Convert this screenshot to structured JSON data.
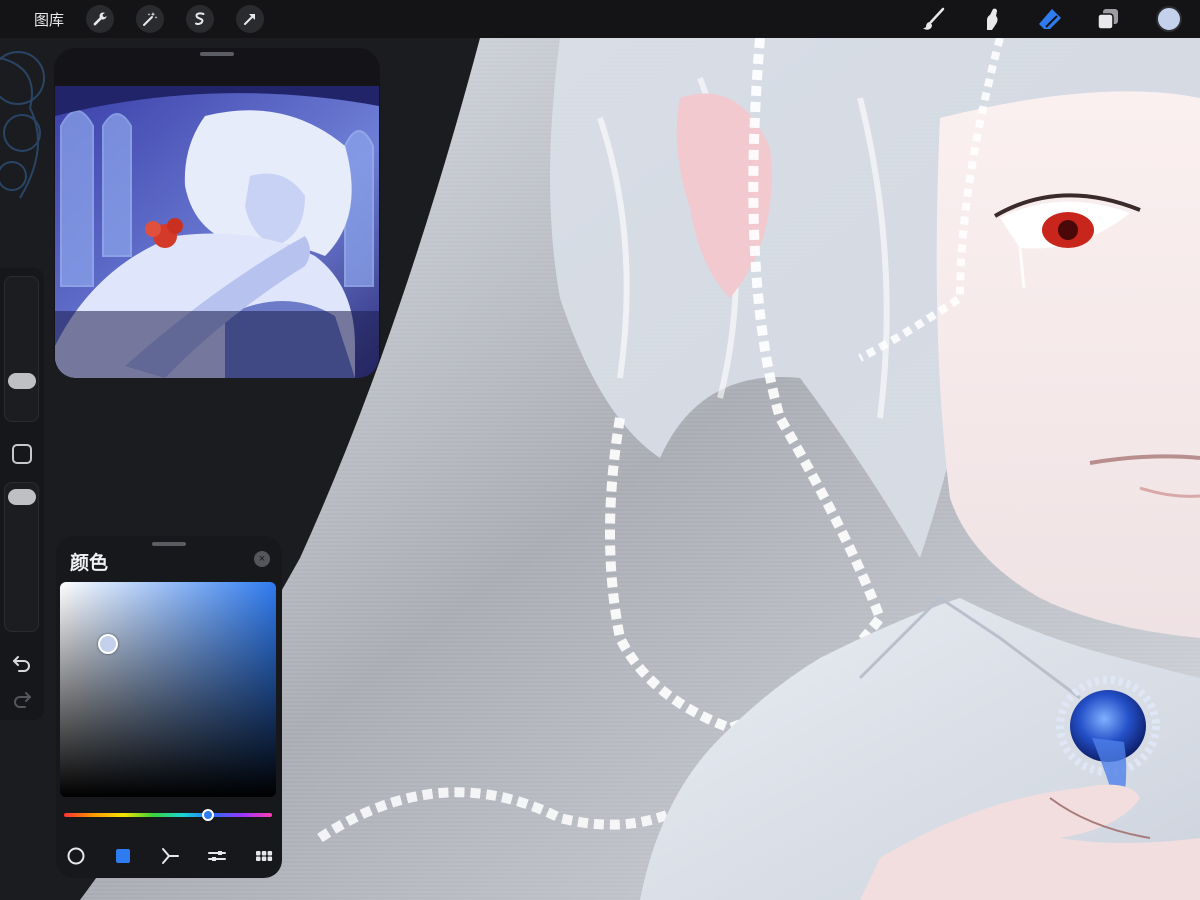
{
  "app": "Procreate",
  "topbar": {
    "gallery_label": "图库",
    "left_tools": [
      "wrench-icon",
      "magic-wand-icon",
      "selection-icon",
      "transform-arrow-icon"
    ],
    "right_tools": [
      "brush-icon",
      "smudge-icon",
      "eraser-icon",
      "layers-icon"
    ],
    "active_tool": "eraser-icon",
    "current_color": "#c3d1ec",
    "accent": "#2f7bf0"
  },
  "sidebar": {
    "controls": [
      "brush-size-slider",
      "modify-button",
      "opacity-slider",
      "undo-icon",
      "redo-icon"
    ]
  },
  "reference_panel": {
    "content": "reference-artwork"
  },
  "color_panel": {
    "title": "颜色",
    "close_label": "×",
    "selected_color": "#c3d1ec",
    "hue_color": "#2f7bf0",
    "modes": [
      "disc-mode-icon",
      "classic-mode-icon",
      "harmony-mode-icon",
      "value-mode-icon",
      "palettes-mode-icon"
    ],
    "active_mode": "classic-mode-icon"
  }
}
